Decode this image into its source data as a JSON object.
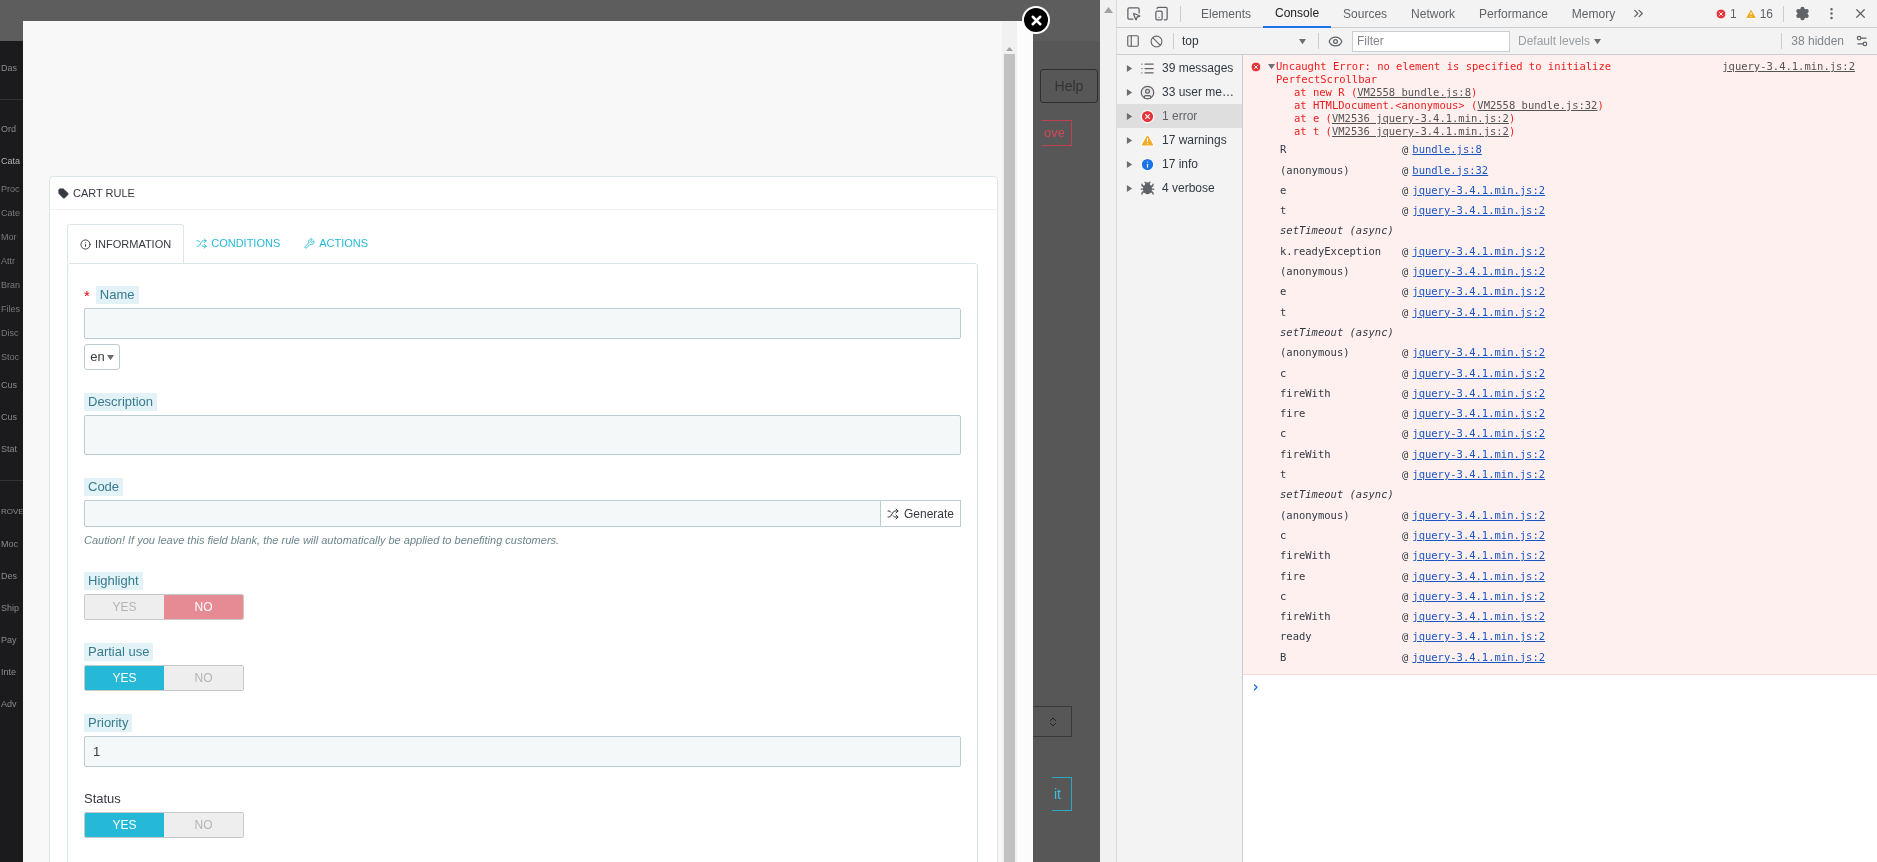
{
  "admin_backdrop": {
    "sidebar": {
      "groups": [
        {
          "items": [
            {
              "label": "Das",
              "kind": "main"
            }
          ]
        },
        {
          "items": [
            {
              "label": "Ord",
              "kind": "main"
            },
            {
              "label": "Cata",
              "kind": "active"
            },
            {
              "label": "Proc",
              "kind": "sub"
            },
            {
              "label": "Cate",
              "kind": "sub"
            },
            {
              "label": "Mor",
              "kind": "sub"
            },
            {
              "label": "Attr",
              "kind": "sub"
            },
            {
              "label": "Bran",
              "kind": "sub"
            },
            {
              "label": "Files",
              "kind": "sub"
            },
            {
              "label": "Disc",
              "kind": "sub"
            },
            {
              "label": "Stoc",
              "kind": "sub"
            },
            {
              "label": "Cus",
              "kind": "main"
            },
            {
              "label": "Cus",
              "kind": "main"
            },
            {
              "label": "Stat",
              "kind": "main"
            }
          ]
        },
        {
          "items": [
            {
              "label": "ROVE",
              "kind": "heading"
            },
            {
              "label": "Moc",
              "kind": "main"
            },
            {
              "label": "Des",
              "kind": "main"
            },
            {
              "label": "Ship",
              "kind": "main"
            },
            {
              "label": "Pay",
              "kind": "main"
            },
            {
              "label": "Inte",
              "kind": "main"
            },
            {
              "label": "Adv",
              "kind": "main"
            }
          ]
        }
      ]
    },
    "right": {
      "help": "Help",
      "remove": "ove",
      "edit": "it"
    }
  },
  "modal": {
    "card_title": "CART RULE",
    "required_mark": "*",
    "tabs": [
      {
        "label": "INFORMATION",
        "selected": true
      },
      {
        "label": "CONDITIONS",
        "selected": false
      },
      {
        "label": "ACTIONS",
        "selected": false
      }
    ],
    "fields": [
      {
        "kind": "text",
        "label": "Name",
        "required": true,
        "has_help": true
      },
      {
        "kind": "language",
        "value": "en"
      },
      {
        "kind": "textarea",
        "label": "Description",
        "required": false,
        "has_help": true
      },
      {
        "kind": "code",
        "label": "Code",
        "required": false,
        "has_help": true,
        "button": "Generate",
        "note": "Caution! If you leave this field blank, the rule will automatically be applied to benefiting customers."
      },
      {
        "kind": "toggle",
        "label": "Highlight",
        "required": false,
        "has_help": true,
        "options": [
          {
            "label": "YES",
            "selected": false
          },
          {
            "label": "NO",
            "selected": true
          }
        ]
      },
      {
        "kind": "toggle",
        "label": "Partial use",
        "required": false,
        "has_help": true,
        "options": [
          {
            "label": "YES",
            "selected": true
          },
          {
            "label": "NO",
            "selected": false
          }
        ]
      },
      {
        "kind": "text",
        "label": "Priority",
        "required": false,
        "has_help": true,
        "value": "1"
      },
      {
        "kind": "toggle",
        "label": "Status",
        "required": false,
        "has_help": false,
        "options": [
          {
            "label": "YES",
            "selected": true
          },
          {
            "label": "NO",
            "selected": false
          }
        ]
      }
    ]
  },
  "devtools": {
    "tabs": [
      {
        "label": "Elements",
        "selected": false
      },
      {
        "label": "Console",
        "selected": true
      },
      {
        "label": "Sources",
        "selected": false
      },
      {
        "label": "Network",
        "selected": false
      },
      {
        "label": "Performance",
        "selected": false
      },
      {
        "label": "Memory",
        "selected": false
      }
    ],
    "error_count": "1",
    "warning_count": "16",
    "context": "top",
    "filter_placeholder": "Filter",
    "levels": "Default levels",
    "hidden": "38 hidden",
    "sidebar": [
      {
        "kind": "messages",
        "label": "39 messages",
        "selected": false
      },
      {
        "kind": "user",
        "label": "33 user me…",
        "selected": false
      },
      {
        "kind": "error",
        "label": "1 error",
        "selected": true
      },
      {
        "kind": "warning",
        "label": "17 warnings",
        "selected": false
      },
      {
        "kind": "info",
        "label": "17 info",
        "selected": false
      },
      {
        "kind": "verbose",
        "label": "4 verbose",
        "selected": false
      }
    ],
    "error": {
      "message": "Uncaught Error: no element is specified to initialize PerfectScrollbar",
      "source": "jquery-3.4.1.min.js:2",
      "stack": [
        {
          "prefix": "at new R (",
          "link": "VM2558 bundle.js:8",
          "suffix": ")"
        },
        {
          "prefix": "at HTMLDocument.<anonymous> (",
          "link": "VM2558 bundle.js:32",
          "suffix": ")"
        },
        {
          "prefix": "at e (",
          "link": "VM2536 jquery-3.4.1.min.js:2",
          "suffix": ")"
        },
        {
          "prefix": "at t (",
          "link": "VM2536 jquery-3.4.1.min.js:2",
          "suffix": ")"
        }
      ],
      "frames": [
        {
          "kind": "frame",
          "fn": "R",
          "at": "@",
          "link": "bundle.js:8"
        },
        {
          "kind": "frame",
          "fn": "(anonymous)",
          "at": "@",
          "link": "bundle.js:32"
        },
        {
          "kind": "frame",
          "fn": "e",
          "at": "@",
          "link": "jquery-3.4.1.min.js:2"
        },
        {
          "kind": "frame",
          "fn": "t",
          "at": "@",
          "link": "jquery-3.4.1.min.js:2"
        },
        {
          "kind": "async",
          "text": "setTimeout (async)"
        },
        {
          "kind": "frame",
          "fn": "k.readyException",
          "at": "@",
          "link": "jquery-3.4.1.min.js:2"
        },
        {
          "kind": "frame",
          "fn": "(anonymous)",
          "at": "@",
          "link": "jquery-3.4.1.min.js:2"
        },
        {
          "kind": "frame",
          "fn": "e",
          "at": "@",
          "link": "jquery-3.4.1.min.js:2"
        },
        {
          "kind": "frame",
          "fn": "t",
          "at": "@",
          "link": "jquery-3.4.1.min.js:2"
        },
        {
          "kind": "async",
          "text": "setTimeout (async)"
        },
        {
          "kind": "frame",
          "fn": "(anonymous)",
          "at": "@",
          "link": "jquery-3.4.1.min.js:2"
        },
        {
          "kind": "frame",
          "fn": "c",
          "at": "@",
          "link": "jquery-3.4.1.min.js:2"
        },
        {
          "kind": "frame",
          "fn": "fireWith",
          "at": "@",
          "link": "jquery-3.4.1.min.js:2"
        },
        {
          "kind": "frame",
          "fn": "fire",
          "at": "@",
          "link": "jquery-3.4.1.min.js:2"
        },
        {
          "kind": "frame",
          "fn": "c",
          "at": "@",
          "link": "jquery-3.4.1.min.js:2"
        },
        {
          "kind": "frame",
          "fn": "fireWith",
          "at": "@",
          "link": "jquery-3.4.1.min.js:2"
        },
        {
          "kind": "frame",
          "fn": "t",
          "at": "@",
          "link": "jquery-3.4.1.min.js:2"
        },
        {
          "kind": "async",
          "text": "setTimeout (async)"
        },
        {
          "kind": "frame",
          "fn": "(anonymous)",
          "at": "@",
          "link": "jquery-3.4.1.min.js:2"
        },
        {
          "kind": "frame",
          "fn": "c",
          "at": "@",
          "link": "jquery-3.4.1.min.js:2"
        },
        {
          "kind": "frame",
          "fn": "fireWith",
          "at": "@",
          "link": "jquery-3.4.1.min.js:2"
        },
        {
          "kind": "frame",
          "fn": "fire",
          "at": "@",
          "link": "jquery-3.4.1.min.js:2"
        },
        {
          "kind": "frame",
          "fn": "c",
          "at": "@",
          "link": "jquery-3.4.1.min.js:2"
        },
        {
          "kind": "frame",
          "fn": "fireWith",
          "at": "@",
          "link": "jquery-3.4.1.min.js:2"
        },
        {
          "kind": "frame",
          "fn": "ready",
          "at": "@",
          "link": "jquery-3.4.1.min.js:2"
        },
        {
          "kind": "frame",
          "fn": "B",
          "at": "@",
          "link": "jquery-3.4.1.min.js:2"
        }
      ]
    },
    "prompt": "›"
  }
}
